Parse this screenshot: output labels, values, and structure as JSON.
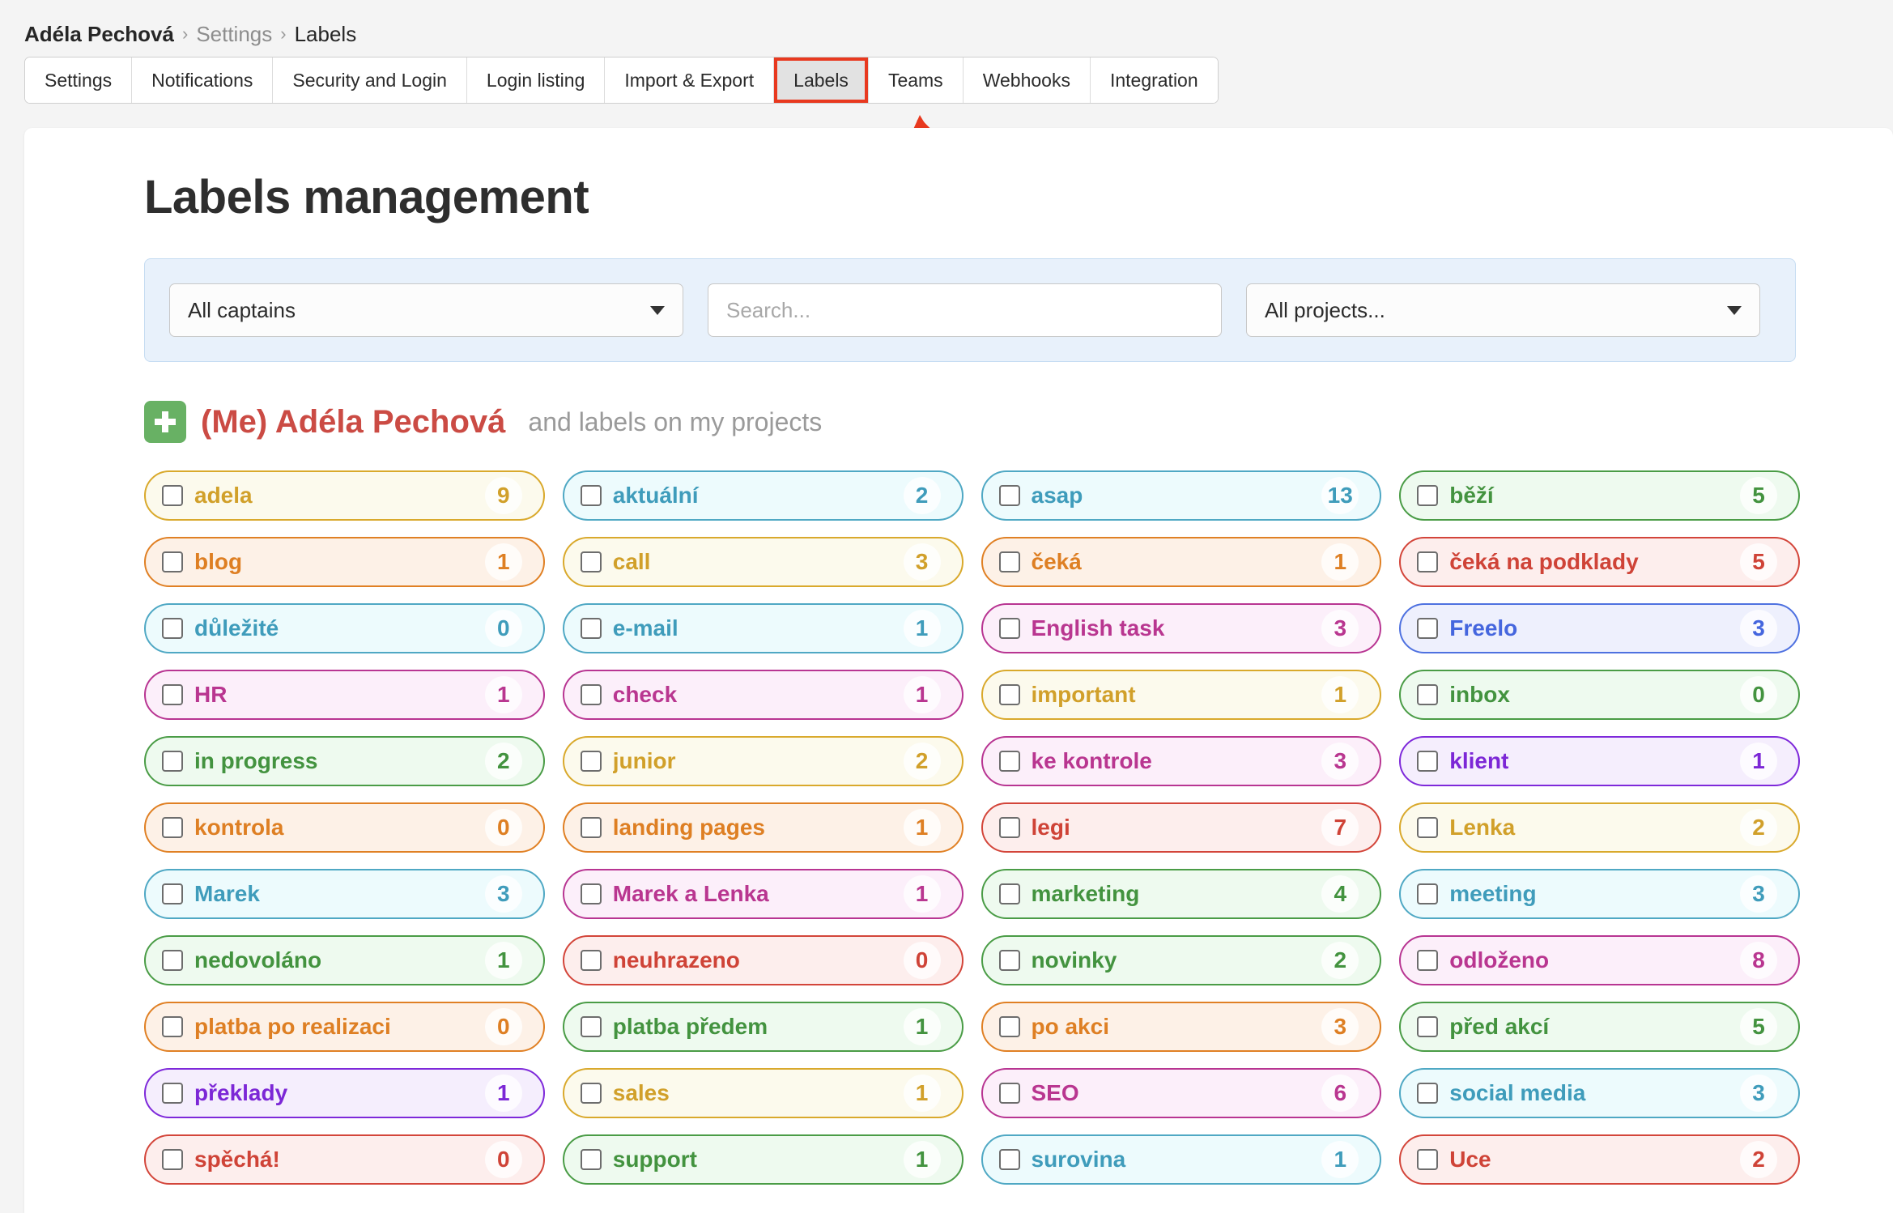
{
  "breadcrumb": {
    "user": "Adéla Pechová",
    "separator": "›",
    "section": "Settings",
    "current": "Labels"
  },
  "tabs": [
    {
      "label": "Settings",
      "active": false
    },
    {
      "label": "Notifications",
      "active": false
    },
    {
      "label": "Security and Login",
      "active": false
    },
    {
      "label": "Login listing",
      "active": false
    },
    {
      "label": "Import & Export",
      "active": false
    },
    {
      "label": "Labels",
      "active": true
    },
    {
      "label": "Teams",
      "active": false
    },
    {
      "label": "Webhooks",
      "active": false
    },
    {
      "label": "Integration",
      "active": false
    }
  ],
  "page": {
    "title": "Labels management"
  },
  "filters": {
    "captains_value": "All captains",
    "search_placeholder": "Search...",
    "projects_value": "All projects..."
  },
  "group": {
    "add_label": "+",
    "name": "(Me) Adéla Pechová",
    "subtitle": "and labels on my projects"
  },
  "colors": {
    "yellow": {
      "border": "#d9a92c",
      "bg": "#fcfaed",
      "text": "#d1a02a"
    },
    "cyan": {
      "border": "#4fa8c4",
      "bg": "#edfbfd",
      "text": "#3f9cbb"
    },
    "orange": {
      "border": "#e08024",
      "bg": "#fdf1e7",
      "text": "#de7f23"
    },
    "green": {
      "border": "#4a9c46",
      "bg": "#eefaef",
      "text": "#43933f"
    },
    "red": {
      "border": "#d3453a",
      "bg": "#fdeeed",
      "text": "#cf4337"
    },
    "magenta": {
      "border": "#b83592",
      "bg": "#fceffa",
      "text": "#b93690"
    },
    "blue": {
      "border": "#4e71e0",
      "bg": "#eef0fd",
      "text": "#4566de"
    },
    "purple": {
      "border": "#7e29da",
      "bg": "#f5eefd",
      "text": "#7c27d6"
    }
  },
  "labels": [
    {
      "name": "adela",
      "count": "9",
      "color": "yellow"
    },
    {
      "name": "aktuální",
      "count": "2",
      "color": "cyan"
    },
    {
      "name": "asap",
      "count": "13",
      "color": "cyan"
    },
    {
      "name": "běží",
      "count": "5",
      "color": "green"
    },
    {
      "name": "blog",
      "count": "1",
      "color": "orange"
    },
    {
      "name": "call",
      "count": "3",
      "color": "yellow"
    },
    {
      "name": "čeká",
      "count": "1",
      "color": "orange"
    },
    {
      "name": "čeká na podklady",
      "count": "5",
      "color": "red"
    },
    {
      "name": "důležité",
      "count": "0",
      "color": "cyan"
    },
    {
      "name": "e-mail",
      "count": "1",
      "color": "cyan"
    },
    {
      "name": "English task",
      "count": "3",
      "color": "magenta"
    },
    {
      "name": "Freelo",
      "count": "3",
      "color": "blue"
    },
    {
      "name": "HR",
      "count": "1",
      "color": "magenta"
    },
    {
      "name": "check",
      "count": "1",
      "color": "magenta"
    },
    {
      "name": "important",
      "count": "1",
      "color": "yellow"
    },
    {
      "name": "inbox",
      "count": "0",
      "color": "green"
    },
    {
      "name": "in progress",
      "count": "2",
      "color": "green"
    },
    {
      "name": "junior",
      "count": "2",
      "color": "yellow"
    },
    {
      "name": "ke kontrole",
      "count": "3",
      "color": "magenta"
    },
    {
      "name": "klient",
      "count": "1",
      "color": "purple"
    },
    {
      "name": "kontrola",
      "count": "0",
      "color": "orange"
    },
    {
      "name": "landing pages",
      "count": "1",
      "color": "orange"
    },
    {
      "name": "legi",
      "count": "7",
      "color": "red"
    },
    {
      "name": "Lenka",
      "count": "2",
      "color": "yellow"
    },
    {
      "name": "Marek",
      "count": "3",
      "color": "cyan"
    },
    {
      "name": "Marek a Lenka",
      "count": "1",
      "color": "magenta"
    },
    {
      "name": "marketing",
      "count": "4",
      "color": "green"
    },
    {
      "name": "meeting",
      "count": "3",
      "color": "cyan"
    },
    {
      "name": "nedovoláno",
      "count": "1",
      "color": "green"
    },
    {
      "name": "neuhrazeno",
      "count": "0",
      "color": "red"
    },
    {
      "name": "novinky",
      "count": "2",
      "color": "green"
    },
    {
      "name": "odloženo",
      "count": "8",
      "color": "magenta"
    },
    {
      "name": "platba po realizaci",
      "count": "0",
      "color": "orange"
    },
    {
      "name": "platba předem",
      "count": "1",
      "color": "green"
    },
    {
      "name": "po akci",
      "count": "3",
      "color": "orange"
    },
    {
      "name": "před akcí",
      "count": "5",
      "color": "green"
    },
    {
      "name": "překlady",
      "count": "1",
      "color": "purple"
    },
    {
      "name": "sales",
      "count": "1",
      "color": "yellow"
    },
    {
      "name": "SEO",
      "count": "6",
      "color": "magenta"
    },
    {
      "name": "social media",
      "count": "3",
      "color": "cyan"
    },
    {
      "name": "spěchá!",
      "count": "0",
      "color": "red"
    },
    {
      "name": "support",
      "count": "1",
      "color": "green"
    },
    {
      "name": "surovina",
      "count": "1",
      "color": "cyan"
    },
    {
      "name": "Uce",
      "count": "2",
      "color": "red"
    }
  ],
  "annotation": {
    "arrow_color": "#e8391f"
  }
}
